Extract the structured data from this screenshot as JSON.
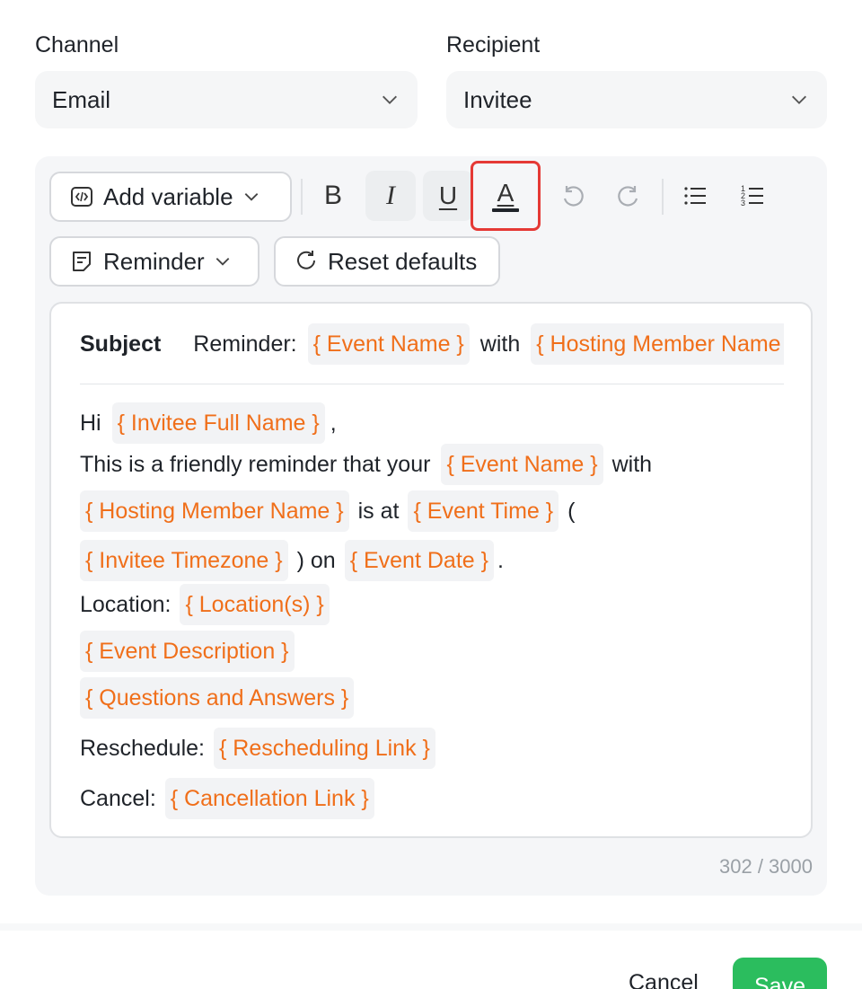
{
  "channel": {
    "label": "Channel",
    "value": "Email"
  },
  "recipient": {
    "label": "Recipient",
    "value": "Invitee"
  },
  "toolbar": {
    "add_variable": "Add variable",
    "bold": "B",
    "italic": "I",
    "underline": "U",
    "text_color": "A",
    "template": "Reminder",
    "reset_defaults": "Reset defaults"
  },
  "subject": {
    "label": "Subject",
    "prefix": "Reminder:",
    "var1": "{ Event Name }",
    "with": "with",
    "var2": "{ Hosting Member Name }"
  },
  "body": {
    "hi": "Hi",
    "invitee_full_name": "{ Invitee Full Name }",
    "comma": ",",
    "friendly": "This is a friendly reminder that your",
    "event_name": "{ Event Name }",
    "with": "with",
    "hosting_member_name": "{ Hosting Member Name }",
    "is_at": "is at",
    "event_time": "{ Event Time }",
    "open_paren": "(",
    "invitee_timezone": "{ Invitee Timezone }",
    "close_on": ") on",
    "event_date": "{ Event Date }",
    "period": ".",
    "location_label": "Location:",
    "locations": "{ Location(s) }",
    "event_description": "{ Event Description }",
    "questions_answers": "{ Questions and Answers }",
    "reschedule_label": "Reschedule:",
    "rescheduling_link": "{ Rescheduling Link }",
    "cancel_label": "Cancel:",
    "cancellation_link": "{ Cancellation Link }"
  },
  "counter": "302 / 3000",
  "footer": {
    "cancel": "Cancel",
    "save": "Save"
  },
  "colors": {
    "variable": "#f06f1a",
    "save": "#2bbd5e",
    "highlight": "#e53935"
  },
  "icons": [
    "chevron-down-icon",
    "code-icon",
    "bold-icon",
    "italic-icon",
    "underline-icon",
    "text-color-icon",
    "undo-icon",
    "redo-icon",
    "bullet-list-icon",
    "numbered-list-icon",
    "note-icon",
    "refresh-icon"
  ]
}
